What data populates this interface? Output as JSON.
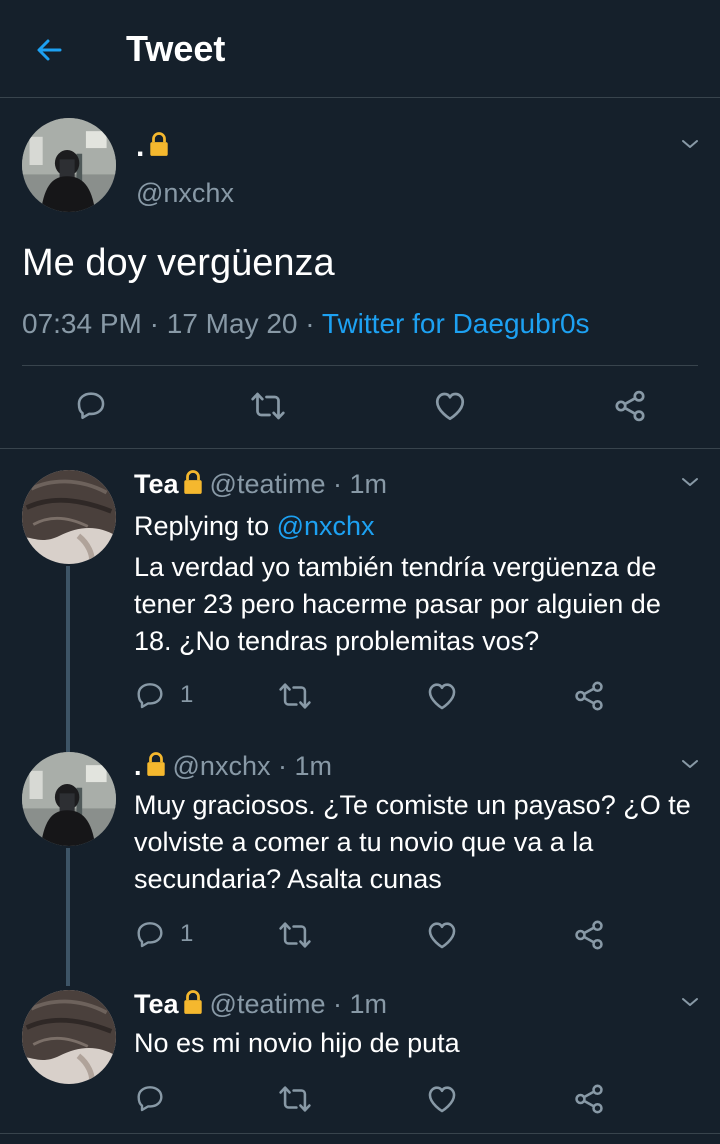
{
  "header": {
    "title": "Tweet"
  },
  "main_tweet": {
    "name": ".",
    "handle": "@nxchx",
    "text": "Me doy vergüenza",
    "time": "07:34 PM",
    "date": "17 May 20",
    "source": "Twitter for Daegubr0s"
  },
  "replies": [
    {
      "name": "Tea",
      "handle": "@teatime",
      "sep": "·",
      "time": "1m",
      "replying_label": "Replying to",
      "replying_to": "@nxchx",
      "text": "La verdad yo también tendría vergüenza de tener 23 pero hacerme pasar por alguien de 18. ¿No tendras problemitas vos?",
      "reply_count": "1"
    },
    {
      "name": ".",
      "handle": "@nxchx",
      "sep": "·",
      "time": "1m",
      "text": "Muy graciosos. ¿Te comiste un payaso? ¿O te volviste a comer a tu novio que va a la secundaria? Asalta cunas",
      "reply_count": "1"
    },
    {
      "name": "Tea",
      "handle": "@teatime",
      "sep": "·",
      "time": "1m",
      "text": "No es mi novio hijo de puta",
      "reply_count": ""
    }
  ],
  "icons": {
    "back": "arrow-left-icon",
    "lock": "lock-icon",
    "chevron": "chevron-down-icon",
    "reply": "reply-icon",
    "retweet": "retweet-icon",
    "like": "heart-icon",
    "share": "share-icon"
  },
  "colors": {
    "background": "#15202b",
    "accent": "#1da1f2",
    "muted": "#8899a6",
    "lock": "#f5b82e"
  }
}
